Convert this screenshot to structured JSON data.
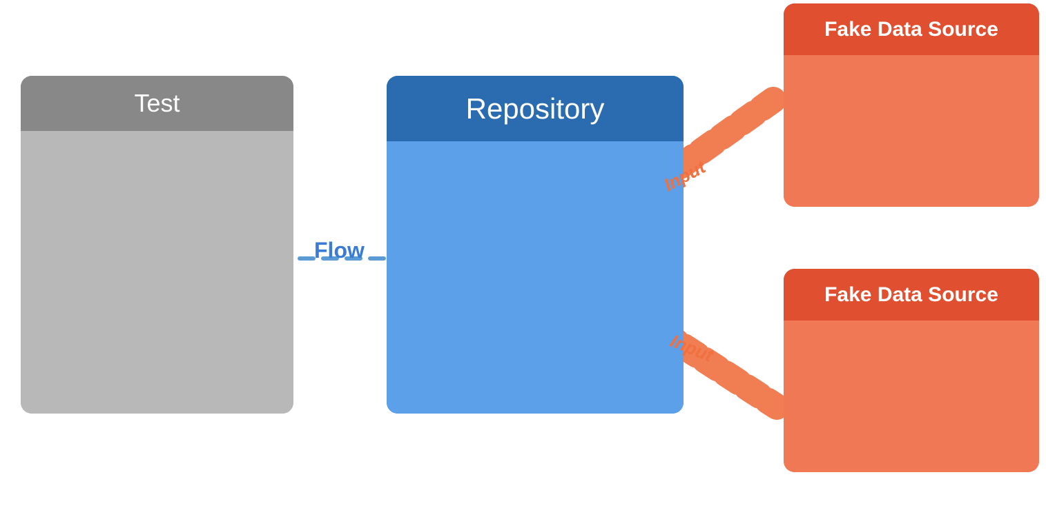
{
  "test_block": {
    "header_label": "Test"
  },
  "repo_block": {
    "header_label": "Repository"
  },
  "fake_block_top": {
    "header_label": "Fake Data Source"
  },
  "fake_block_bottom": {
    "header_label": "Fake Data Source"
  },
  "flow_label": "Flow",
  "input_label_top": "Input",
  "input_label_bottom": "Input",
  "colors": {
    "test_header": "#888888",
    "test_body": "#b8b8b8",
    "repo_header": "#2b6cb0",
    "repo_body": "#5ba0e8",
    "fake_header": "#e05030",
    "fake_body": "#f07855",
    "flow_text": "#3a7bd5",
    "input_text": "#f07040",
    "connector_blue": "#5b9bd5",
    "connector_orange": "#f07040"
  }
}
